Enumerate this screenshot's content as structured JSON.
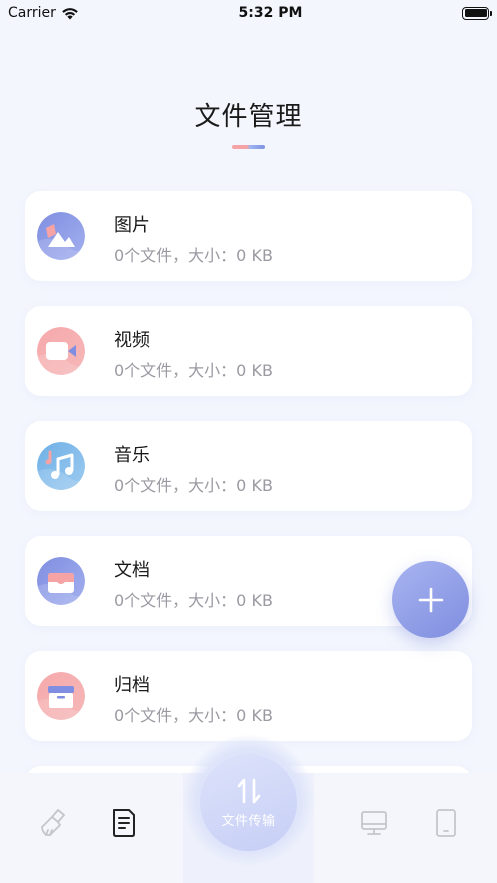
{
  "status_bar": {
    "carrier": "Carrier",
    "time": "5:32 PM"
  },
  "header": {
    "title": "文件管理"
  },
  "categories": [
    {
      "label": "图片",
      "info": "0个文件，大小：0 KB",
      "icon": "image-icon"
    },
    {
      "label": "视频",
      "info": "0个文件，大小：0 KB",
      "icon": "video-icon"
    },
    {
      "label": "音乐",
      "info": "0个文件，大小：0 KB",
      "icon": "music-icon"
    },
    {
      "label": "文档",
      "info": "0个文件，大小：0 KB",
      "icon": "document-icon"
    },
    {
      "label": "归档",
      "info": "0个文件，大小：0 KB",
      "icon": "archive-icon"
    }
  ],
  "tab_bar": {
    "items": [
      {
        "icon": "broom-icon",
        "active": false
      },
      {
        "icon": "document-icon",
        "active": true
      },
      {
        "icon": "monitor-icon",
        "active": false
      },
      {
        "icon": "phone-icon",
        "active": false
      }
    ],
    "center_label": "文件传输"
  },
  "colors": {
    "accent_blue": "#7f8ee0",
    "accent_pink": "#f5a3a5",
    "music_blue": "#7ab6e8",
    "background": "#f3f6fd"
  }
}
